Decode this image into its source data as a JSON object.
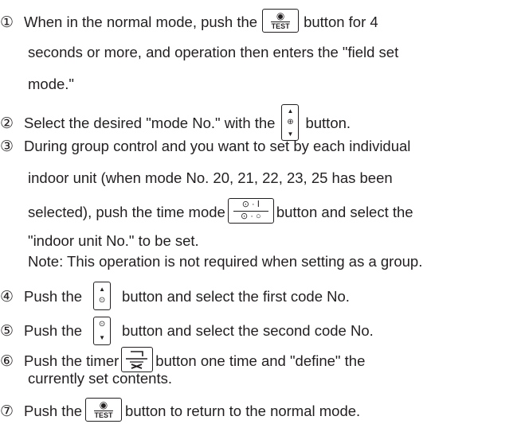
{
  "steps": [
    {
      "num": "①",
      "lines": [
        [
          "When in the normal mode, push the",
          "button for 4"
        ],
        [
          "seconds or more, and operation then enters the \"field set"
        ],
        [
          "mode.\""
        ]
      ]
    },
    {
      "num": "②",
      "lines": [
        [
          "Select the desired \"mode No.\" with the",
          "button."
        ]
      ]
    },
    {
      "num": "③",
      "lines": [
        [
          "During group control and you want to set by each individual"
        ],
        [
          "indoor unit (when mode No. 20, 21, 22, 23, 25 has been"
        ],
        [
          "selected), push the time mode",
          "button and select the"
        ],
        [
          "\"indoor unit No.\" to be set."
        ],
        [
          "Note: This operation is not required when setting as a group."
        ]
      ]
    },
    {
      "num": "④",
      "lines": [
        [
          "Push the",
          "button and select the first code No."
        ]
      ]
    },
    {
      "num": "⑤",
      "lines": [
        [
          "Push the",
          "button and select the second code No."
        ]
      ]
    },
    {
      "num": "⑥",
      "lines": [
        [
          "Push the timer",
          "button one time and \"define\" the"
        ],
        [
          "currently set contents."
        ]
      ]
    },
    {
      "num": "⑦",
      "lines": [
        [
          "Push the",
          "button to return to the normal mode."
        ]
      ]
    }
  ],
  "icons": {
    "test_label": "TEST",
    "eye_glyph": "◉",
    "up_glyph": "▲",
    "down_glyph": "▼",
    "updown_mid_glyph": "⊕",
    "clock_glyph": "⊙",
    "time_mode_top": "⊙ · Ⅰ",
    "time_mode_bottom": "⊙ · ○"
  }
}
